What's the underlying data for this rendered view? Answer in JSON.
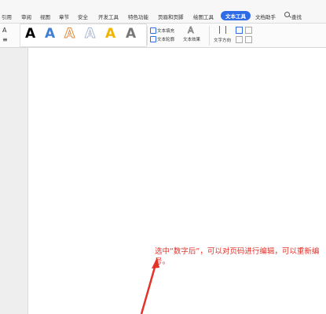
{
  "tabs": [
    {
      "label": "引用"
    },
    {
      "label": "审阅"
    },
    {
      "label": "视图"
    },
    {
      "label": "章节"
    },
    {
      "label": "安全"
    },
    {
      "label": "开发工具"
    },
    {
      "label": "特色功能"
    },
    {
      "label": "页眉和页脚"
    },
    {
      "label": "绘图工具"
    },
    {
      "label": "文本工具",
      "active": true
    },
    {
      "label": "文档助手"
    },
    {
      "label": "查找"
    }
  ],
  "ribbon": {
    "art_letters": [
      {
        "glyph": "A",
        "color": "#111111",
        "style": "solid"
      },
      {
        "glyph": "A",
        "color": "#3f7fd6",
        "style": "solid"
      },
      {
        "glyph": "A",
        "color": "#e88a3b",
        "style": "outline"
      },
      {
        "glyph": "A",
        "color": "#a9b8d8",
        "style": "outline"
      },
      {
        "glyph": "A",
        "color": "#f3b400",
        "style": "solid"
      },
      {
        "glyph": "A",
        "color": "#777777",
        "style": "solid"
      }
    ],
    "text_fill": "文本填充",
    "text_outline": "文本轮廓",
    "text_effect": "文本效果",
    "text_direction": "文字方向",
    "effect_glyph": "A",
    "left_glyphs": {
      "a": "A",
      "b": "≡"
    }
  },
  "annotation": {
    "text": "选中“数字后”，可以对页码进行编辑，可以重新编号。",
    "color": "#e4322b"
  },
  "colors": {
    "accent": "#2f6be6",
    "annotation": "#e4322b"
  }
}
